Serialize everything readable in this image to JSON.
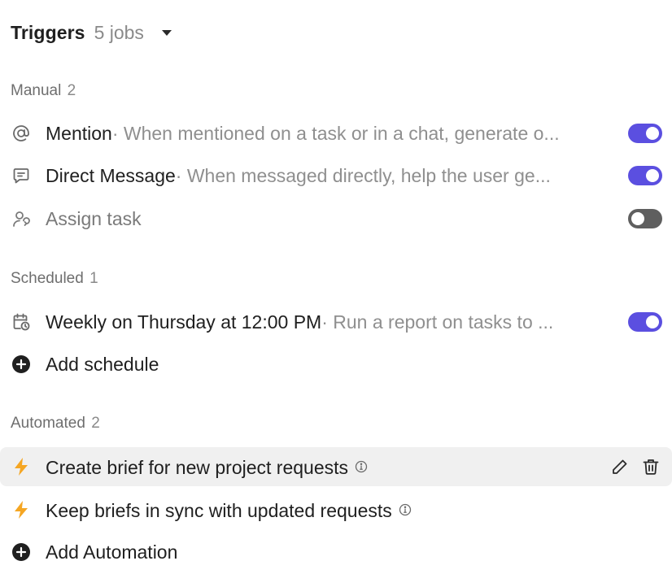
{
  "header": {
    "title": "Triggers",
    "count": "5 jobs"
  },
  "sections": {
    "manual": {
      "label": "Manual",
      "count": "2",
      "items": [
        {
          "name": "Mention",
          "description": "· When mentioned on a task or in a chat, generate o...",
          "icon": "at-icon",
          "enabled": true
        },
        {
          "name": "Direct Message",
          "description": "· When messaged directly, help the user ge...",
          "icon": "message-icon",
          "enabled": true
        },
        {
          "name": "Assign task",
          "description": "",
          "icon": "assign-icon",
          "enabled": false
        }
      ]
    },
    "scheduled": {
      "label": "Scheduled",
      "count": "1",
      "items": [
        {
          "name": "Weekly on Thursday at 12:00 PM",
          "description": "· Run a report on tasks to ...",
          "icon": "calendar-clock-icon",
          "enabled": true
        }
      ],
      "add_label": "Add schedule"
    },
    "automated": {
      "label": "Automated",
      "count": "2",
      "items": [
        {
          "name": "Create brief for new project requests",
          "icon": "lightning-icon"
        },
        {
          "name": "Keep briefs in sync with updated requests",
          "icon": "lightning-icon"
        }
      ],
      "add_label": "Add Automation"
    }
  },
  "colors": {
    "toggle_on": "#5b4fe0",
    "toggle_off": "#5f5f5f",
    "lightning": "#f5a623",
    "hover_row": "#f0f0f0"
  }
}
